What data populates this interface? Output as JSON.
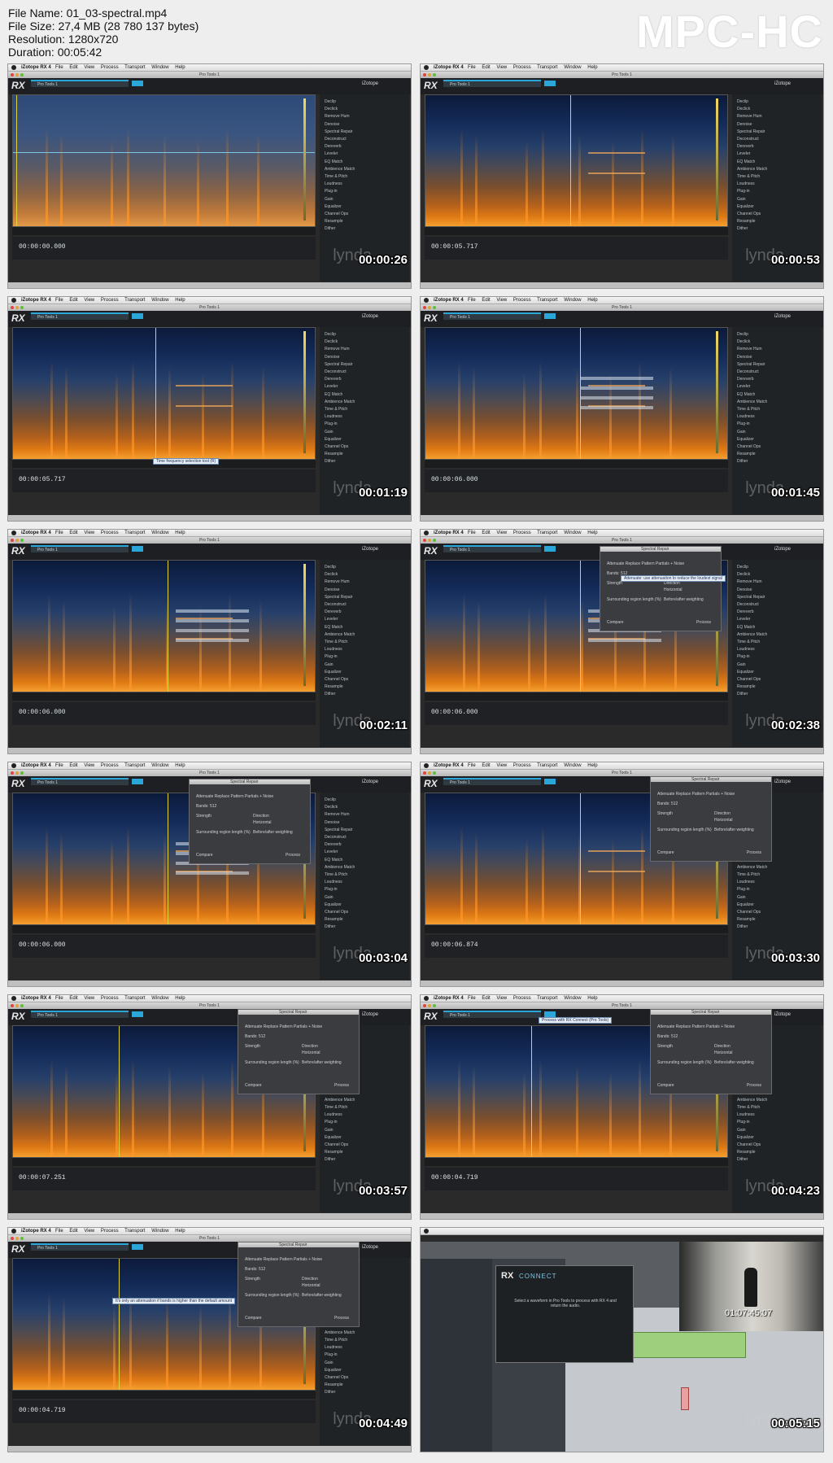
{
  "file_info": {
    "name": "File Name: 01_03-spectral.mp4",
    "size": "File Size: 27,4 MB (28 780 137 bytes)",
    "resolution": "Resolution: 1280x720",
    "duration": "Duration: 00:05:42"
  },
  "brand": "MPC-HC",
  "app": {
    "menu_app": "iZotope RX 4",
    "menu_items": "File Edit View Process Transport Window Help",
    "window_title": "Pro Tools 1",
    "tab_label": "Pro Tools 1",
    "izotope_label": "iZotope",
    "watermark": "lynda"
  },
  "effects": [
    "Declip",
    "Declick",
    "Remove Hum",
    "Denoise",
    "Spectral Repair",
    "Deconstruct",
    "Dereverb",
    "Leveler",
    "EQ Match",
    "Ambience Match",
    "Time & Pitch",
    "Loudness",
    "Plug-in",
    "Gain",
    "Equalizer",
    "Channel Ops",
    "Resample",
    "Dither"
  ],
  "dialog": {
    "title": "Spectral Repair",
    "tabs": "Attenuate  Replace  Pattern  Partials + Noise",
    "bands": "Bands: 512",
    "strength": "Strength",
    "direction": "Direction",
    "horizontal": "Horizontal",
    "surround": "Surrounding region length (%)",
    "before_after": "Before/after weighting",
    "compare": "Compare",
    "process": "Process"
  },
  "hints": {
    "f3": "Time frequency selection tool (R)",
    "f6": "Attenuate: use attenuation to reduce the loudest signal",
    "f10": "Process with RX Connect (Pro Tools)",
    "f11": "It's only an attenuation if bands is higher than the default amount"
  },
  "frames": [
    {
      "timecode": "00:00:00.000",
      "stamp": "00:00:26"
    },
    {
      "timecode": "00:00:05.717",
      "stamp": "00:00:53"
    },
    {
      "timecode": "00:00:05.717",
      "stamp": "00:01:19"
    },
    {
      "timecode": "00:00:06.000",
      "stamp": "00:01:45"
    },
    {
      "timecode": "00:00:06.000",
      "stamp": "00:02:11"
    },
    {
      "timecode": "00:00:06.000",
      "stamp": "00:02:38"
    },
    {
      "timecode": "00:00:06.000",
      "stamp": "00:03:04"
    },
    {
      "timecode": "00:00:06.874",
      "stamp": "00:03:30"
    },
    {
      "timecode": "00:00:07.251",
      "stamp": "00:03:57"
    },
    {
      "timecode": "00:00:04.719",
      "stamp": "00:04:23"
    },
    {
      "timecode": "00:00:04.719",
      "stamp": "00:04:49"
    },
    {
      "timecode": "",
      "stamp": "00:05:15"
    }
  ],
  "protools": {
    "connect_label": "CONNECT",
    "connect_msg": "Select a waveform in Pro Tools to process with RX 4 and return the audio.",
    "video_timecode": "01:07:45:07"
  },
  "colors": {
    "accent": "#2aa6d8",
    "playhead": "#e2d23c",
    "spectro_hot": "#e07a14"
  }
}
